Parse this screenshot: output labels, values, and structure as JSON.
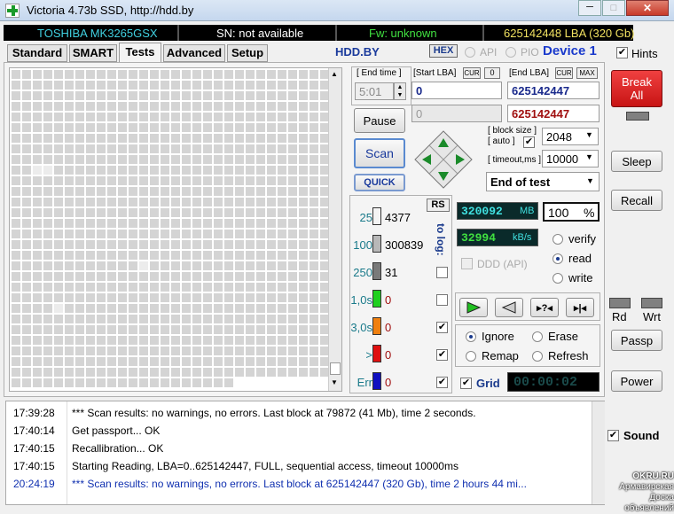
{
  "window": {
    "title": "Victoria 4.73b SSD, http://hdd.by"
  },
  "info_bar": {
    "model": "TOSHIBA MK3265GSX",
    "serial": "SN: not available",
    "firmware": "Fw: unknown",
    "capacity": "625142448 LBA (320 Gb)"
  },
  "tabs": [
    "Standard",
    "SMART",
    "Tests",
    "Advanced",
    "Setup"
  ],
  "active_tab": "Tests",
  "header": {
    "site": "HDD.BY",
    "hex": "HEX",
    "api": "API",
    "pio": "PIO",
    "device": "Device 1",
    "hints": "Hints"
  },
  "controls": {
    "end_time_label": "[ End time ]",
    "end_time_value": "5:01",
    "start_lba_label": "[Start LBA]",
    "cur_label": "CUR",
    "zero_label": "0",
    "start_lba": "0",
    "start_lba_cur": "0",
    "end_lba_label": "[End LBA]",
    "max_label": "MAX",
    "end_lba": "625142447",
    "end_lba_cur": "625142447",
    "pause": "Pause",
    "scan": "Scan",
    "quick": "QUICK",
    "block_size_label": "[ block size ]",
    "auto_label": "[ auto ]",
    "block_size": "2048",
    "timeout_label": "[ timeout,ms ]",
    "timeout": "10000",
    "end_action": "End of test"
  },
  "side": {
    "break_all": "Break All",
    "sleep": "Sleep",
    "recall": "Recall",
    "rd": "Rd",
    "wrt": "Wrt",
    "passp": "Passp",
    "power": "Power",
    "sound": "Sound"
  },
  "stats": {
    "rs": "RS",
    "to_log": "to log:",
    "rows": [
      {
        "label": "25",
        "count": "4377",
        "color": "#f4f4f4"
      },
      {
        "label": "100",
        "count": "300839",
        "color": "#b8b8b8"
      },
      {
        "label": "250",
        "count": "31",
        "color": "#7a7a7a"
      },
      {
        "label": "1,0s",
        "count": "0",
        "color": "#20d020"
      },
      {
        "label": "3,0s",
        "count": "0",
        "color": "#f08010"
      },
      {
        "label": ">",
        "count": "0",
        "color": "#e01010"
      },
      {
        "label": "Err",
        "count": "0",
        "color": "#1010c0"
      }
    ]
  },
  "readouts": {
    "mb_value": "320092",
    "mb_unit": "MB",
    "percent": "100",
    "percent_unit": "%",
    "speed": "32994",
    "speed_unit": "kB/s",
    "ddd": "DDD (API)"
  },
  "modes": {
    "verify": "verify",
    "read": "read",
    "write": "write",
    "selected": "read"
  },
  "actions": {
    "ignore": "Ignore",
    "erase": "Erase",
    "remap": "Remap",
    "refresh": "Refresh",
    "selected": "Ignore",
    "grid": "Grid",
    "timer": "00:00:02"
  },
  "log": [
    {
      "time": "17:39:28",
      "text": "*** Scan results: no warnings, no errors. Last block at 79872 (41 Mb), time 2 seconds.",
      "color": "#000000"
    },
    {
      "time": "17:40:14",
      "text": "Get passport... OK",
      "color": "#000000"
    },
    {
      "time": "17:40:15",
      "text": "Recallibration... OK",
      "color": "#000000"
    },
    {
      "time": "17:40:15",
      "text": "Starting Reading, LBA=0..625142447, FULL, sequential access, timeout 10000ms",
      "color": "#000000"
    },
    {
      "time": "20:24:19",
      "text": "*** Scan results: no warnings, no errors. Last block at 625142447 (320 Gb), time 2 hours 44 mi...",
      "color": "#1030b0"
    }
  ],
  "watermark": {
    "line1": "OKRU.RU",
    "line2": "Армавирская",
    "line3": "Доска объявлений"
  },
  "colors": {
    "accent": "#1a3a8c",
    "break": "#e02020",
    "lcd_bg": "#0a2a2a",
    "lcd_text": "#40e0e0",
    "lcd_green": "#40e040"
  }
}
